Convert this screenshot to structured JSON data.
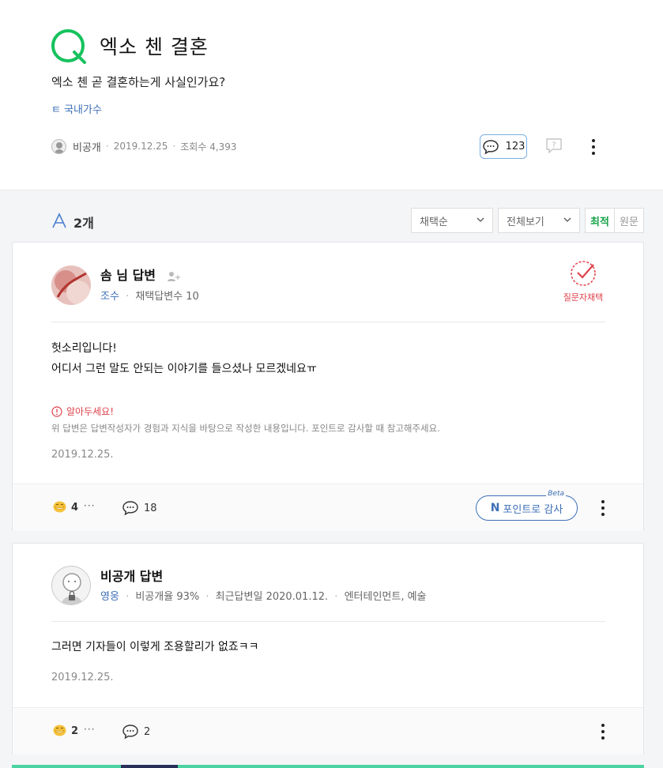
{
  "question": {
    "title": "엑소 첸 결혼",
    "body": "엑소 첸 곧 결혼하는게 사실인가요?",
    "category": "ㅌ 국내가수",
    "author": "비공개",
    "date": "2019.12.25",
    "views_label": "조회수 4,393",
    "comment_count": "123"
  },
  "answers_bar": {
    "count": "2개",
    "sort_select": "채택순",
    "view_select": "전체보기",
    "sort_latest": "최적",
    "sort_original": "원문"
  },
  "answers": [
    {
      "name": "솜 님 답변",
      "level": "조수",
      "stats": "채택답변수 10",
      "selected_label": "질문자채택",
      "lines": [
        "헛소리입니다!",
        "어디서 그런 말도 안되는 이야기를 들으셨나 모르겠네요ㅠ"
      ],
      "notice_title": "알아두세요!",
      "notice_desc": "위 답변은 답변작성자가 경험과 지식을 바탕으로 작성한 내용입니다. 포인트로 감사할 때 참고해주세요.",
      "date": "2019.12.25.",
      "likes": "4",
      "comments": "18",
      "point_button": "포인트로 감사",
      "beta": "Beta"
    },
    {
      "name": "비공개 답변",
      "level": "영웅",
      "stats": "비공개율 93%",
      "recent": "최근답변일 2020.01.12.",
      "fields": "엔터테인먼트, 예술",
      "lines": [
        "그러면 기자들이 이렇게 조용할리가 없죠ㅋㅋ"
      ],
      "date": "2019.12.25.",
      "likes": "2",
      "comments": "2"
    }
  ],
  "colors": {
    "q_green": "#16c25d",
    "link_blue": "#3d6fb6",
    "alert_red": "#e0424b",
    "sort_green": "#16a34a"
  }
}
